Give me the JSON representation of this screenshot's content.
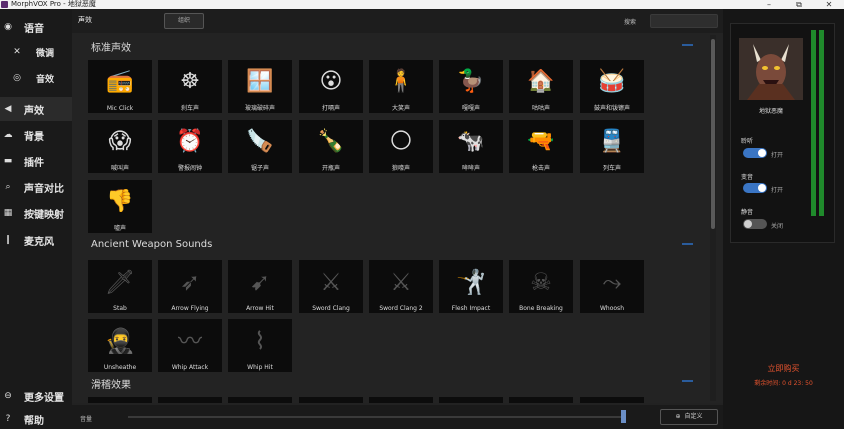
{
  "window": {
    "title": "MorphVOX Pro - 地狱恶魔",
    "minimize": "–",
    "maximize": "⧉",
    "close": "✕"
  },
  "sidebar": {
    "items": [
      {
        "label": "语音",
        "icon": "person-voice-icon",
        "glyph": "◉"
      },
      {
        "label": "微调",
        "icon": "tools-icon",
        "glyph": "✕"
      },
      {
        "label": "音效",
        "icon": "ring-icon",
        "glyph": "◎"
      },
      {
        "label": "声效",
        "icon": "speaker-icon",
        "glyph": "◀"
      },
      {
        "label": "背景",
        "icon": "cloud-icon",
        "glyph": "☁"
      },
      {
        "label": "插件",
        "icon": "plug-icon",
        "glyph": "▬"
      },
      {
        "label": "声音对比",
        "icon": "search-icon",
        "glyph": "⌕"
      },
      {
        "label": "按键映射",
        "icon": "keyboard-icon",
        "glyph": "▦"
      },
      {
        "label": "麦克风",
        "icon": "microphone-icon",
        "glyph": "❙"
      }
    ],
    "more_settings": "更多设置",
    "help": "帮助"
  },
  "topbar": {
    "title": "声效",
    "organize_button": "组织",
    "search_label": "搜索",
    "search_placeholder": ""
  },
  "sections": [
    {
      "title": "标准声效",
      "tiles": [
        {
          "label": "Mic Click",
          "icon": "walkie-talkie-icon",
          "glyph": "📻"
        },
        {
          "label": "刹车声",
          "icon": "steering-wheel-icon",
          "glyph": "☸"
        },
        {
          "label": "玻璃破碎声",
          "icon": "broken-window-icon",
          "glyph": "🪟"
        },
        {
          "label": "打嗝声",
          "icon": "burping-face-icon",
          "glyph": "😮"
        },
        {
          "label": "大笑声",
          "icon": "laughing-person-icon",
          "glyph": "🧍"
        },
        {
          "label": "嘎嘎声",
          "icon": "duck-icon",
          "glyph": "🦆"
        },
        {
          "label": "咕咕声",
          "icon": "cuckoo-clock-icon",
          "glyph": "🏠"
        },
        {
          "label": "鼓声和钹镲声",
          "icon": "drum-icon",
          "glyph": "🥁"
        },
        {
          "label": "喊叫声",
          "icon": "screaming-woman-icon",
          "glyph": "😱"
        },
        {
          "label": "警报闹钟",
          "icon": "alarm-clock-icon",
          "glyph": "⏰"
        },
        {
          "label": "锯子声",
          "icon": "saw-icon",
          "glyph": "🪚"
        },
        {
          "label": "开瓶声",
          "icon": "bottle-icon",
          "glyph": "🍾"
        },
        {
          "label": "狼嚎声",
          "icon": "wolf-moon-icon",
          "glyph": "🌕"
        },
        {
          "label": "哞哞声",
          "icon": "cow-icon",
          "glyph": "🐄"
        },
        {
          "label": "枪击声",
          "icon": "gun-icon",
          "glyph": "🔫"
        },
        {
          "label": "列车声",
          "icon": "train-icon",
          "glyph": "🚆"
        },
        {
          "label": "嘘声",
          "icon": "thumbs-down-icon",
          "glyph": "👎"
        }
      ]
    },
    {
      "title": "Ancient Weapon Sounds",
      "tiles": [
        {
          "label": "Stab",
          "icon": "dagger-icon",
          "glyph": "🗡"
        },
        {
          "label": "Arrow Flying",
          "icon": "arrows-icon",
          "glyph": "➶"
        },
        {
          "label": "Arrow Hit",
          "icon": "arrow-hit-icon",
          "glyph": "➹"
        },
        {
          "label": "Sword Clang",
          "icon": "crossed-swords-icon",
          "glyph": "⚔"
        },
        {
          "label": "Sword Clang 2",
          "icon": "crossed-swords-icon",
          "glyph": "⚔"
        },
        {
          "label": "Flesh Impact",
          "icon": "fighter-icon",
          "glyph": "🤺"
        },
        {
          "label": "Bone Breaking",
          "icon": "bone-icon",
          "glyph": "☠"
        },
        {
          "label": "Whoosh",
          "icon": "whoosh-icon",
          "glyph": "⤳"
        },
        {
          "label": "Unsheathe",
          "icon": "ninja-icon",
          "glyph": "🥷"
        },
        {
          "label": "Whip Attack",
          "icon": "whip-icon",
          "glyph": "〰"
        },
        {
          "label": "Whip Hit",
          "icon": "whip-hit-icon",
          "glyph": "⌇"
        }
      ]
    },
    {
      "title": "滑稽效果",
      "tiles": []
    }
  ],
  "bottombar": {
    "volume_label": "音量",
    "volume_level": 0.99,
    "custom_button": "自定义"
  },
  "voice_panel": {
    "voice_name": "地狱恶魔",
    "listen_label": "聆听",
    "listen_state": "打开",
    "listen_on": true,
    "morph_label": "变音",
    "morph_state": "打开",
    "morph_on": true,
    "mute_label": "静音",
    "mute_state": "关闭",
    "mute_on": false,
    "buy_now": "立即购买",
    "time_left": "剩余时间: 0 d 23: 50"
  },
  "colors": {
    "accent": "#3a75c4",
    "meter": "#1f8a2b",
    "promo": "#e4532e"
  }
}
